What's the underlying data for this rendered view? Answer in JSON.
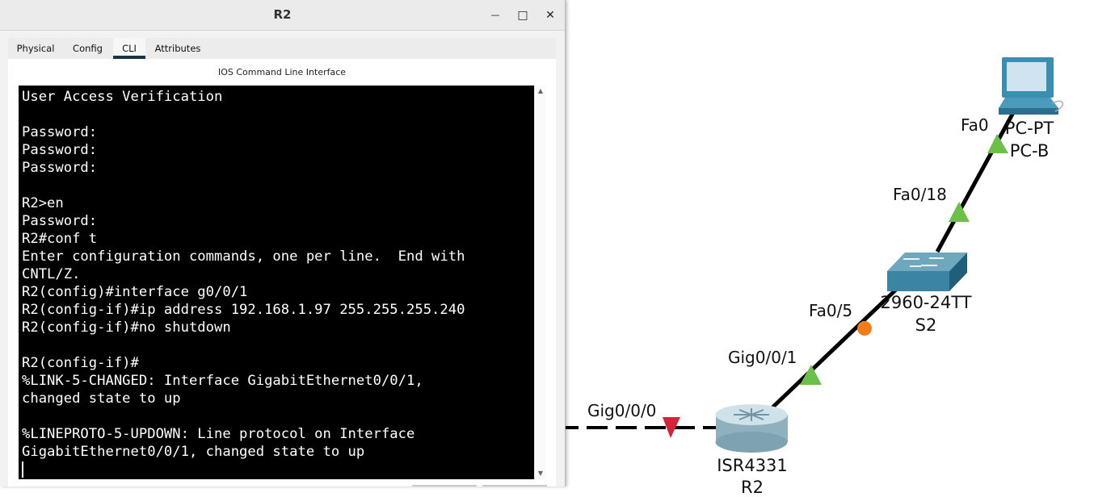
{
  "window": {
    "title": "R2",
    "minimize_glyph": "—",
    "maximize_glyph": "□",
    "close_glyph": "✕"
  },
  "tabs": [
    {
      "label": "Physical",
      "active": false
    },
    {
      "label": "Config",
      "active": false
    },
    {
      "label": "CLI",
      "active": true
    },
    {
      "label": "Attributes",
      "active": false
    }
  ],
  "cli": {
    "heading": "IOS Command Line Interface",
    "output": "User Access Verification\n\nPassword: \nPassword: \nPassword: \n\nR2>en\nPassword: \nR2#conf t\nEnter configuration commands, one per line.  End with\nCNTL/Z.\nR2(config)#interface g0/0/1\nR2(config-if)#ip address 192.168.1.97 255.255.255.240\nR2(config-if)#no shutdown\n\nR2(config-if)#\n%LINK-5-CHANGED: Interface GigabitEthernet0/0/1,\nchanged state to up\n\n%LINEPROTO-5-UPDOWN: Line protocol on Interface\nGigabitEthernet0/0/1, changed state to up\n"
  },
  "scrollbar": {
    "up": "▲",
    "down": "▼"
  },
  "topology": {
    "pc": {
      "model": "PC-PT",
      "name": "PC-B",
      "icon": "pc-icon"
    },
    "switch": {
      "model": "2960-24TT",
      "name": "S2",
      "icon": "switch-icon"
    },
    "router": {
      "model": "ISR4331",
      "name": "R2",
      "icon": "router-icon"
    },
    "ports": {
      "pc_fa0": "Fa0",
      "sw_fa018": "Fa0/18",
      "sw_fa05": "Fa0/5",
      "r_gig001": "Gig0/0/1",
      "r_gig000": "Gig0/0/0"
    },
    "status_colors": {
      "up": "#6cc04a",
      "down": "#d4223b",
      "pending": "#f07d1a"
    }
  }
}
